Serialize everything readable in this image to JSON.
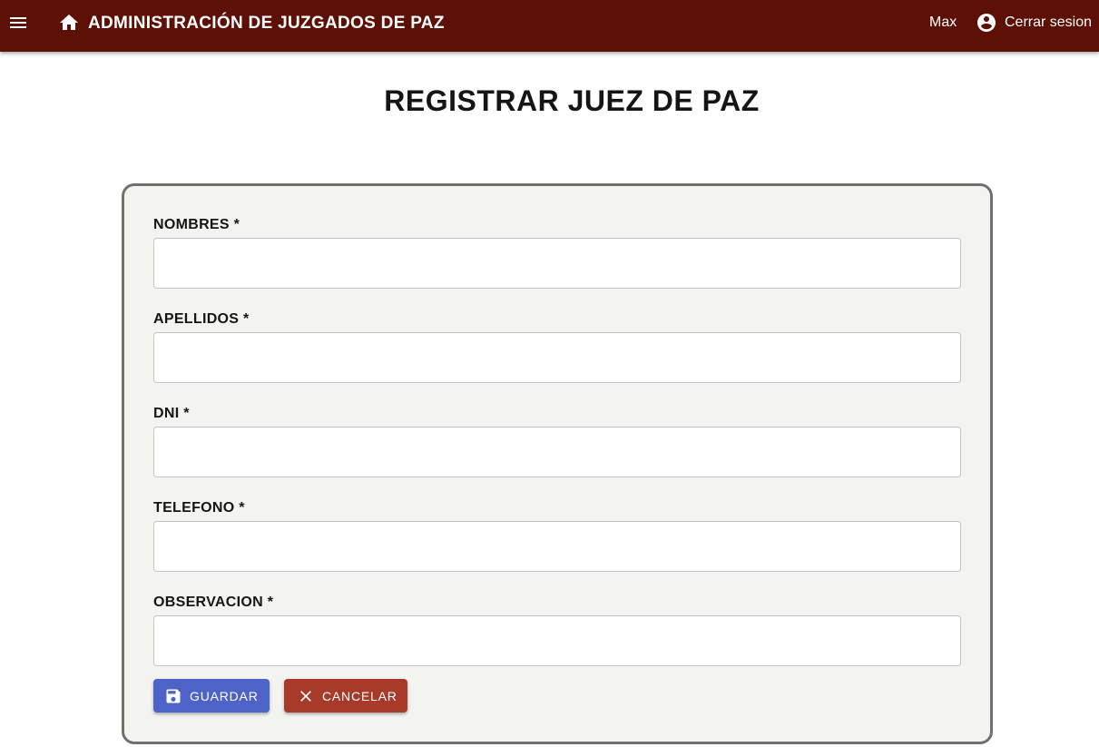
{
  "header": {
    "title": "ADMINISTRACIÓN DE JUZGADOS DE PAZ",
    "user_name": "Max",
    "logout_label": "Cerrar sesion",
    "menu_icon": "menu-icon",
    "home_icon": "home-icon",
    "account_icon": "account-circle-icon",
    "background_color": "#5c1006"
  },
  "page": {
    "title": "REGISTRAR JUEZ DE PAZ"
  },
  "form": {
    "fields": [
      {
        "label": "NOMBRES *",
        "value": ""
      },
      {
        "label": "APELLIDOS *",
        "value": ""
      },
      {
        "label": "DNI *",
        "value": ""
      },
      {
        "label": "TELEFONO *",
        "value": ""
      },
      {
        "label": "OBSERVACION *",
        "value": ""
      }
    ],
    "save_label": "GUARDAR",
    "save_icon": "save-icon",
    "save_color": "#4e63c8",
    "cancel_label": "CANCELAR",
    "cancel_icon": "close-icon",
    "cancel_color": "#a83a2a"
  }
}
